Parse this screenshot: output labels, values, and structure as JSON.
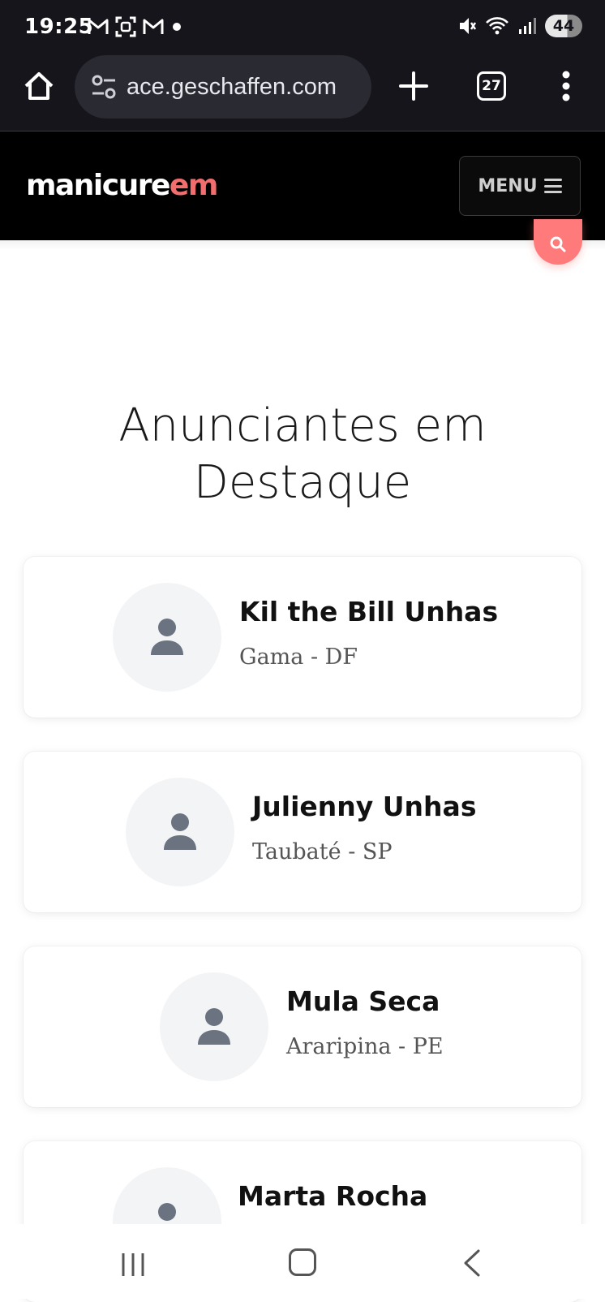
{
  "status_bar": {
    "time": "19:25",
    "battery": "44",
    "left_icons": [
      "gmail-icon",
      "screenshot-icon",
      "gmail-icon",
      "dot-icon"
    ],
    "right_icons": [
      "mute-icon",
      "wifi-icon",
      "signal-icon"
    ]
  },
  "browser": {
    "url": "ace.geschaffen.com",
    "tab_count": "27"
  },
  "site": {
    "logo_part1": "manicure",
    "logo_part2": "em",
    "menu_label": "MENU",
    "accent_color": "#f26d6d"
  },
  "main": {
    "section_title": "Anunciantes em Destaque",
    "advertisers": [
      {
        "name": "Kil the Bill Unhas",
        "location": "Gama - DF"
      },
      {
        "name": "Julienny Unhas",
        "location": "Taubaté - SP"
      },
      {
        "name": "Mula Seca",
        "location": "Araripina - PE"
      },
      {
        "name": "Marta Rocha",
        "location": ""
      }
    ]
  }
}
